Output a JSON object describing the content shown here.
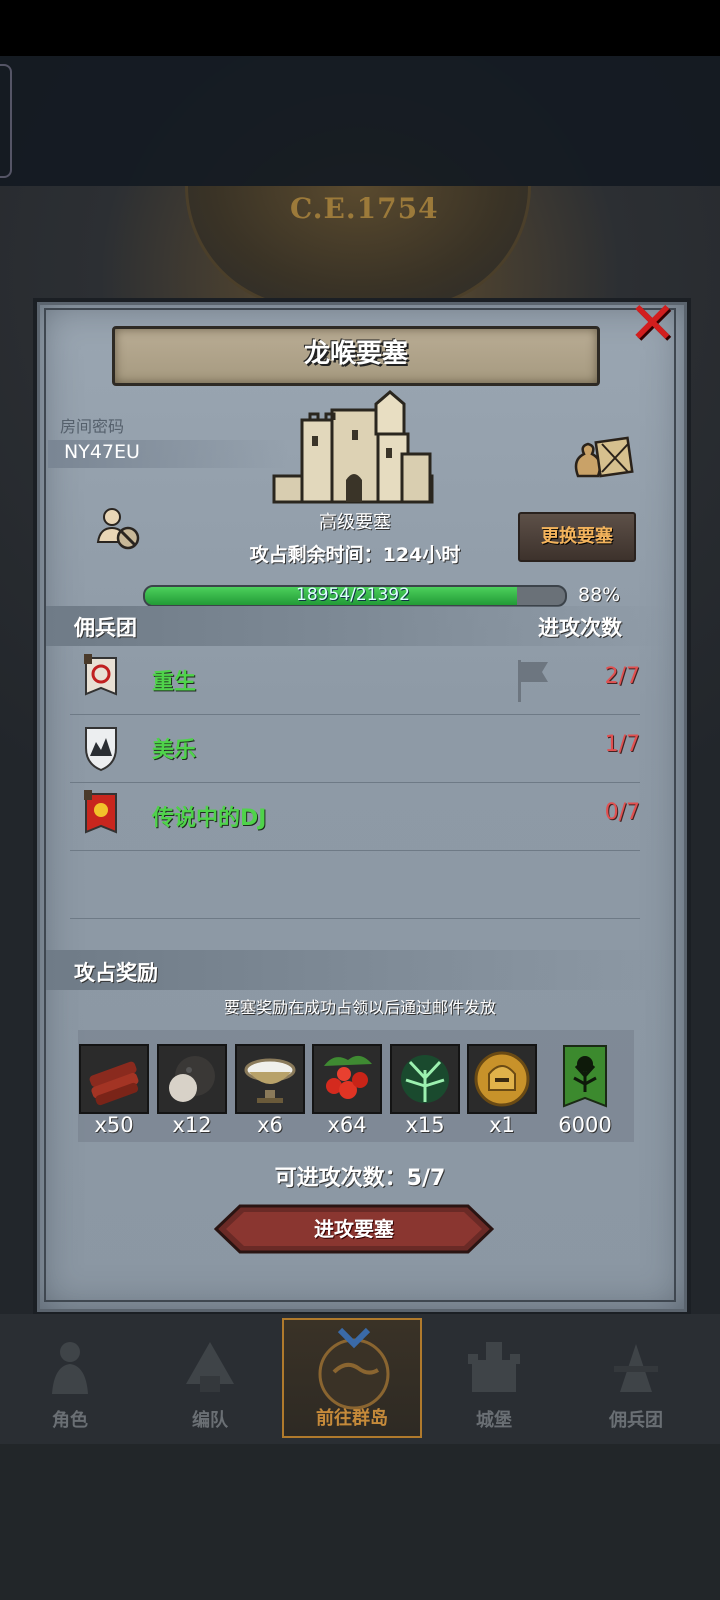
{
  "background": {
    "era_label": "C.E.1754"
  },
  "modal": {
    "title": "龙喉要塞",
    "close_icon": "close-x-icon",
    "room": {
      "label": "房间密码",
      "code": "NY47EU"
    },
    "fortress": {
      "grade": "高级要塞",
      "swap_button": "更换要塞",
      "timer_text": "攻占剩余时间：124小时",
      "progress": {
        "current": 18954,
        "max": 21392,
        "text": "18954/21392",
        "percent_label": "88%",
        "fraction": 0.886
      }
    },
    "mercenaries": {
      "header_left": "佣兵团",
      "header_right": "进攻次数",
      "rows": [
        {
          "name": "重生",
          "count": "2/7",
          "icon": "banner-red-white-icon",
          "has_flag": true
        },
        {
          "name": "美乐",
          "count": "1/7",
          "icon": "shield-mountain-icon",
          "has_flag": false
        },
        {
          "name": "传说中的DJ",
          "count": "0/7",
          "icon": "banner-sun-icon",
          "has_flag": false
        }
      ]
    },
    "rewards": {
      "header": "攻占奖励",
      "note": "要塞奖励在成功占领以后通过邮件发放",
      "items": [
        {
          "icon": "wood-logs-icon",
          "qty": "x50"
        },
        {
          "icon": "truffle-icon",
          "qty": "x12"
        },
        {
          "icon": "salt-bowl-icon",
          "qty": "x6"
        },
        {
          "icon": "berries-icon",
          "qty": "x64"
        },
        {
          "icon": "green-tree-spirit-icon",
          "qty": "x15"
        },
        {
          "icon": "golden-helmet-icon",
          "qty": "x1"
        },
        {
          "icon": "tree-banner-icon",
          "qty": "6000"
        }
      ]
    },
    "attacks_left": "可进攻次数：5/7",
    "attack_button": "进攻要塞"
  },
  "nav": {
    "items": [
      {
        "label": "角色",
        "icon": "knight-icon",
        "active": false
      },
      {
        "label": "编队",
        "icon": "formation-icon",
        "active": false
      },
      {
        "label": "前往群岛",
        "icon": "globe-icon",
        "active": true
      },
      {
        "label": "城堡",
        "icon": "castle-icon",
        "active": false
      },
      {
        "label": "佣兵团",
        "icon": "mercenary-icon",
        "active": false
      }
    ]
  },
  "colors": {
    "accent_gold": "#c58a3a",
    "progress_green": "#2fbf45",
    "member_name_green": "#4fd34a",
    "count_red": "#e05050",
    "close_red": "#d21e1e"
  }
}
